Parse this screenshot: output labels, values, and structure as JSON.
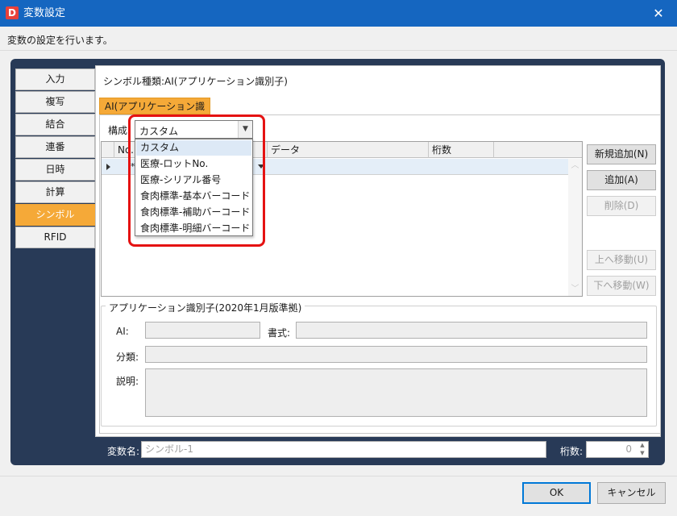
{
  "window": {
    "icon_letter": "D",
    "title": "変数設定",
    "close_glyph": "✕",
    "subtitle": "変数の設定を行います。"
  },
  "side_tabs": [
    {
      "label": "入力"
    },
    {
      "label": "複写"
    },
    {
      "label": "結合"
    },
    {
      "label": "連番"
    },
    {
      "label": "日時"
    },
    {
      "label": "計算"
    },
    {
      "label": "シンボル",
      "active": true
    },
    {
      "label": "RFID"
    }
  ],
  "symbol_type": "シンボル種類:AI(アプリケーション識別子)",
  "inner_tab": "AI(アプリケーション識別子)",
  "composition": {
    "label": "構成:",
    "selected": "カスタム",
    "options": [
      "カスタム",
      "医療-ロットNo.",
      "医療-シリアル番号",
      "食肉標準-基本バーコード",
      "食肉標準-補助バーコード",
      "食肉標準-明細バーコード"
    ]
  },
  "grid": {
    "columns": [
      "No.",
      "",
      "データ",
      "桁数"
    ],
    "new_row_marker": "*"
  },
  "buttons": {
    "new_add": "新規追加(N)",
    "add": "追加(A)",
    "delete": "削除(D)",
    "move_up": "上へ移動(U)",
    "move_down": "下へ移動(W)"
  },
  "app_id_group": {
    "title": "アプリケーション識別子(2020年1月版準拠)",
    "ai_label": "AI:",
    "format_label": "書式:",
    "category_label": "分類:",
    "description_label": "説明:"
  },
  "variable": {
    "name_label": "変数名:",
    "name_value": "シンボル-1",
    "digits_label": "桁数:",
    "digits_value": "0"
  },
  "footer": {
    "ok": "OK",
    "cancel": "キャンセル"
  },
  "colors": {
    "titlebar": "#1566c0",
    "navy_frame": "#283a57",
    "accent_orange": "#f5a938",
    "highlight_red": "#e51212"
  }
}
